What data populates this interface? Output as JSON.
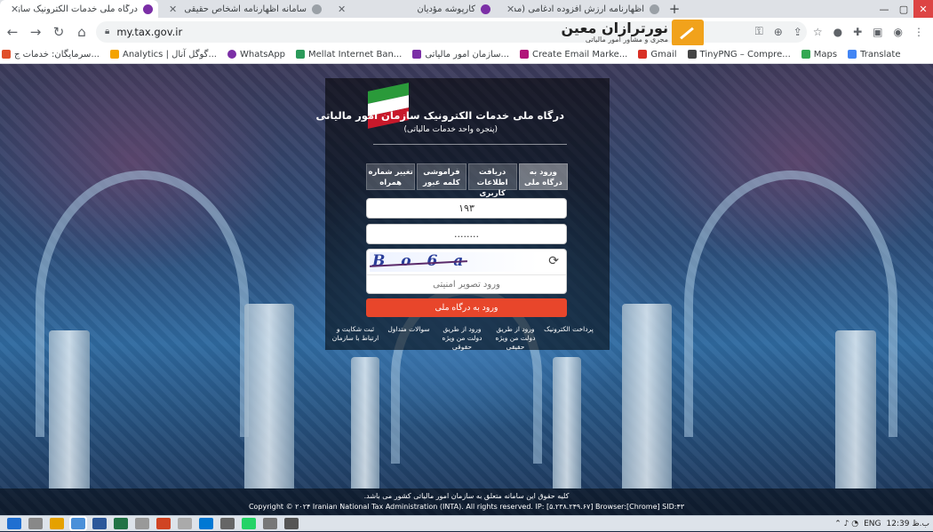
{
  "browser": {
    "tabs": [
      {
        "title": "درگاه ملی خدمات الکترونیک سازمان ...",
        "active": true
      },
      {
        "title": "سامانه اظهارنامه اشخاص حقیقی",
        "active": false
      },
      {
        "title": "کارپوشه مؤدیان",
        "active": false
      },
      {
        "title": "اظهارنامه ارزش افزوده ادغامی (مد...",
        "active": false
      }
    ],
    "url": "my.tax.gov.ir",
    "logo_name": "نورترازان معین",
    "logo_sub": "مجری و مشاور امور مالیاتی",
    "bookmarks": [
      {
        "label": "سرمایگان: خدمات ج...",
        "color": "#e04f2a"
      },
      {
        "label": "Analytics | گوگل آنال...",
        "color": "#f4a300"
      },
      {
        "label": "WhatsApp",
        "color": "#7b2fa6"
      },
      {
        "label": "Mellat Internet Ban...",
        "color": "#2b9a5a"
      },
      {
        "label": "سازمان امور مالیاتی...",
        "color": "#7b2fa6"
      },
      {
        "label": "Create Email Marke...",
        "color": "#b1157a"
      },
      {
        "label": "Gmail",
        "color": "#d93025"
      },
      {
        "label": "TinyPNG – Compre...",
        "color": "#444"
      },
      {
        "label": "Maps",
        "color": "#34a853"
      },
      {
        "label": "Translate",
        "color": "#4285f4"
      }
    ]
  },
  "page": {
    "title": "درگاه ملی خدمات الکترونیک سازمان امور مالیاتی",
    "subtitle": "(پنجره واحد خدمات مالیاتی)",
    "tabs": [
      {
        "label": "ورود به درگاه ملی",
        "active": true
      },
      {
        "label": "دریافت اطلاعات کاربری",
        "active": false
      },
      {
        "label": "فراموشی کلمه عبور",
        "active": false
      },
      {
        "label": "تغییر شماره همراه",
        "active": false
      }
    ],
    "username_value": "۱۹۳",
    "password_value": "........",
    "captcha_text": "B o 6 a",
    "captcha_placeholder": "ورود تصویر امنیتی",
    "submit_label": "ورود به درگاه ملی",
    "links": [
      "پرداخت الکترونیک",
      "ورود از طریق دولت من ویژه حقیقی",
      "ورود از طریق دولت من ویژه حقوقی",
      "سوالات متداول",
      "ثبت شکایت و ارتباط با سازمان"
    ],
    "footer_line1": "کلیه حقوق این سامانه متعلق به سازمان امور مالیاتی کشور می باشد.",
    "footer_line2": "Copyright © ۲۰۲۴ Iranian National Tax Administration (INTA). All rights reserved. IP: [۵.۲۳۸.۲۴۹.۶۷] Browser:[Chrome] SID:۴۳"
  },
  "taskbar": {
    "language": "ENG",
    "time": "12:39 ب.ظ"
  }
}
